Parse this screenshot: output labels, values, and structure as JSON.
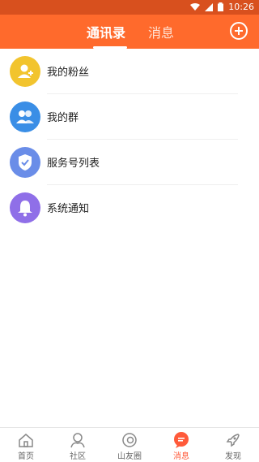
{
  "status": {
    "time": "10:26"
  },
  "header": {
    "tabs": [
      {
        "label": "通讯录",
        "active": true
      },
      {
        "label": "消息",
        "active": false
      }
    ]
  },
  "list": [
    {
      "label": "我的粉丝",
      "icon": "person-add-icon",
      "color": "#f2c42e"
    },
    {
      "label": "我的群",
      "icon": "group-icon",
      "color": "#3a8ee6"
    },
    {
      "label": "服务号列表",
      "icon": "shield-check-icon",
      "color": "#6a8de8"
    },
    {
      "label": "系统通知",
      "icon": "bell-icon",
      "color": "#8f6fe8"
    }
  ],
  "bottom_nav": [
    {
      "label": "首页",
      "icon": "home-icon",
      "active": false
    },
    {
      "label": "社区",
      "icon": "community-icon",
      "active": false
    },
    {
      "label": "山友圈",
      "icon": "camera-ring-icon",
      "active": false
    },
    {
      "label": "消息",
      "icon": "chat-bubble-icon",
      "active": true
    },
    {
      "label": "发现",
      "icon": "rocket-icon",
      "active": false
    }
  ],
  "colors": {
    "header": "#ff6a2c",
    "statusbar": "#d8501e",
    "active": "#ff5a3a"
  }
}
